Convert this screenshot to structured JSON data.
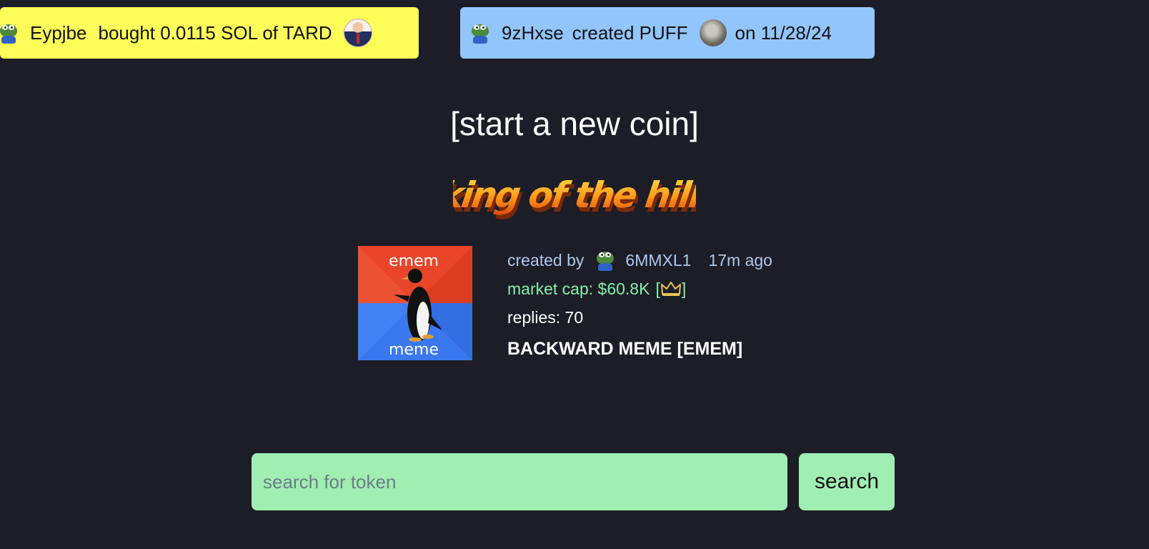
{
  "tickers": {
    "trade": {
      "user": "Eypjbe",
      "text": "bought 0.0115 SOL of TARD",
      "background": "#fdfd5a"
    },
    "create": {
      "user": "9zHxse",
      "text": "created PUFF",
      "date_text": "on 11/28/24",
      "background": "#93c5fd"
    }
  },
  "start_link": "[start a new coin]",
  "king_of_the_hill": {
    "label": "king of the hill"
  },
  "featured_coin": {
    "image_top_text": "emem",
    "image_bottom_text": "meme",
    "created_by_label": "created by",
    "creator": "6MMXL1",
    "age": "17m ago",
    "market_cap_text": "market cap: $60.8K",
    "crown_open": "[",
    "crown_close": "]",
    "crown_icon": "crown-icon",
    "replies_text": "replies: 70",
    "name": "BACKWARD MEME [EMEM]"
  },
  "search": {
    "placeholder": "search for token",
    "value": "",
    "button_label": "search"
  },
  "colors": {
    "background": "#1c1d26",
    "accent_green": "#86efac",
    "search_bg": "#a1eeb3",
    "created_blue": "#aec7ef"
  }
}
